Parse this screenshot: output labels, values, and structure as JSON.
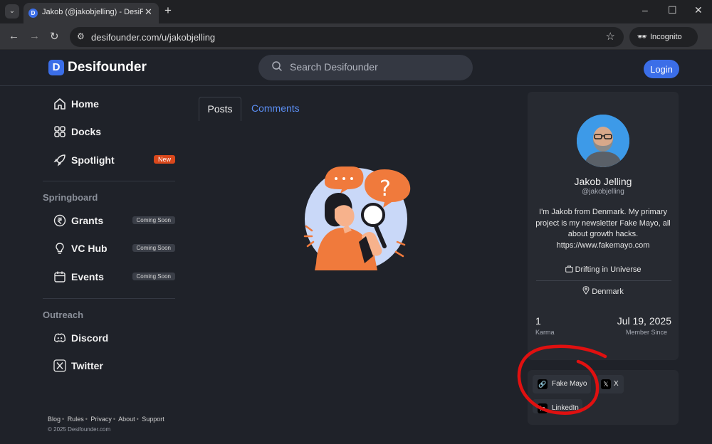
{
  "browser": {
    "tab_title": "Jakob (@jakobjelling) - DesiFounder",
    "url": "desifounder.com/u/jakobjelling",
    "incognito_label": "Incognito"
  },
  "header": {
    "logo_mark": "D",
    "logo_text": "Desifounder",
    "search_placeholder": "Search Desifounder",
    "login_label": "Login"
  },
  "sidebar": {
    "main_items": [
      {
        "label": "Home",
        "icon": "home-icon"
      },
      {
        "label": "Docks",
        "icon": "grid-icon"
      },
      {
        "label": "Spotlight",
        "icon": "rocket-icon",
        "badge": "New"
      }
    ],
    "springboard_title": "Springboard",
    "springboard_items": [
      {
        "label": "Grants",
        "icon": "rupee-icon",
        "badge": "Coming Soon"
      },
      {
        "label": "VC Hub",
        "icon": "lightbulb-icon",
        "badge": "Coming Soon"
      },
      {
        "label": "Events",
        "icon": "calendar-icon",
        "badge": "Coming Soon"
      }
    ],
    "outreach_title": "Outreach",
    "outreach_items": [
      {
        "label": "Discord",
        "icon": "discord-icon"
      },
      {
        "label": "Twitter",
        "icon": "x-icon"
      }
    ],
    "footer_links": [
      "Blog",
      "Rules",
      "Privacy",
      "About",
      "Support"
    ],
    "copyright": "© 2025 Desifounder.com"
  },
  "main": {
    "tabs": [
      {
        "label": "Posts",
        "active": true
      },
      {
        "label": "Comments",
        "active": false
      }
    ]
  },
  "profile": {
    "name": "Jakob Jelling",
    "handle": "@jakobjelling",
    "bio": "I'm Jakob from Denmark. My primary project is my newsletter Fake Mayo, all about growth hacks. https://www.fakemayo.com",
    "status": "Drifting in Universe",
    "location": "Denmark",
    "karma_value": "1",
    "karma_label": "Karma",
    "member_since_value": "Jul 19, 2025",
    "member_since_label": "Member Since"
  },
  "links": [
    {
      "label": "Fake Mayo",
      "icon": "link-icon"
    },
    {
      "label": "X",
      "icon": "x-icon"
    },
    {
      "label": "LinkedIn",
      "icon": "linkedin-icon"
    }
  ],
  "colors": {
    "accent": "#3b6ee8",
    "new_badge": "#d9481c",
    "annotation": "#e01010"
  }
}
